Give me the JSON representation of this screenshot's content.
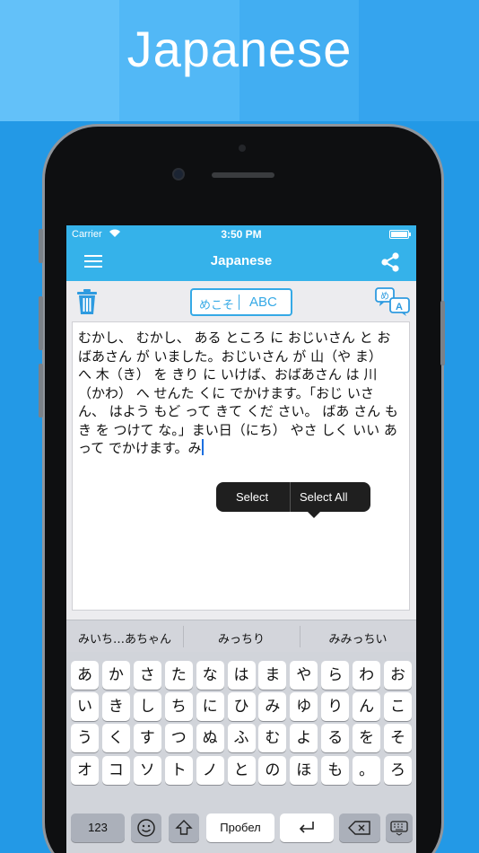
{
  "banner": {
    "title": "Japanese"
  },
  "status": {
    "carrier": "Carrier",
    "time": "3:50 PM"
  },
  "navbar": {
    "title": "Japanese"
  },
  "toolbar": {
    "mode_kana": "めこそ",
    "mode_abc": "ABC"
  },
  "editor": {
    "text": "むかし、 むかし、 ある ところ に おじいさん と おばあさん が いました。おじいさん が 山（や ま） へ 木（き） を きり に いけば、おばあさん は 川（かわ） へ せんた くに でかけます。「おじ いさん、 はよう もど って きて くだ さい。 ばあ さん も き を つけて な。」まい日（にち） やさ しく いい あって でかけます。み"
  },
  "context_menu": {
    "select": "Select",
    "select_all": "Select All"
  },
  "format_buttons": [
    "brush-icon",
    "underline-icon",
    "text-size-icon",
    "color-palette-icon"
  ],
  "suggestions": [
    "みいち…あちゃん",
    "みっちり",
    "みみっちい"
  ],
  "keyboard": {
    "rows": [
      [
        "あ",
        "か",
        "さ",
        "た",
        "な",
        "は",
        "ま",
        "や",
        "ら",
        "わ",
        "お"
      ],
      [
        "い",
        "き",
        "し",
        "ち",
        "に",
        "ひ",
        "み",
        "ゆ",
        "り",
        "ん",
        "こ"
      ],
      [
        "う",
        "く",
        "す",
        "つ",
        "ぬ",
        "ふ",
        "む",
        "よ",
        "る",
        "を",
        "そ"
      ],
      [
        "オ",
        "コ",
        "ソ",
        "ト",
        "ノ",
        "と",
        "の",
        "ほ",
        "も",
        "。",
        "ろ"
      ]
    ],
    "numbers_key": "123",
    "space_key": "Пробел"
  },
  "colors": {
    "accent": "#35b2ea",
    "banner": "#2f9fe8",
    "keyboard_bg": "#d1d4da"
  }
}
